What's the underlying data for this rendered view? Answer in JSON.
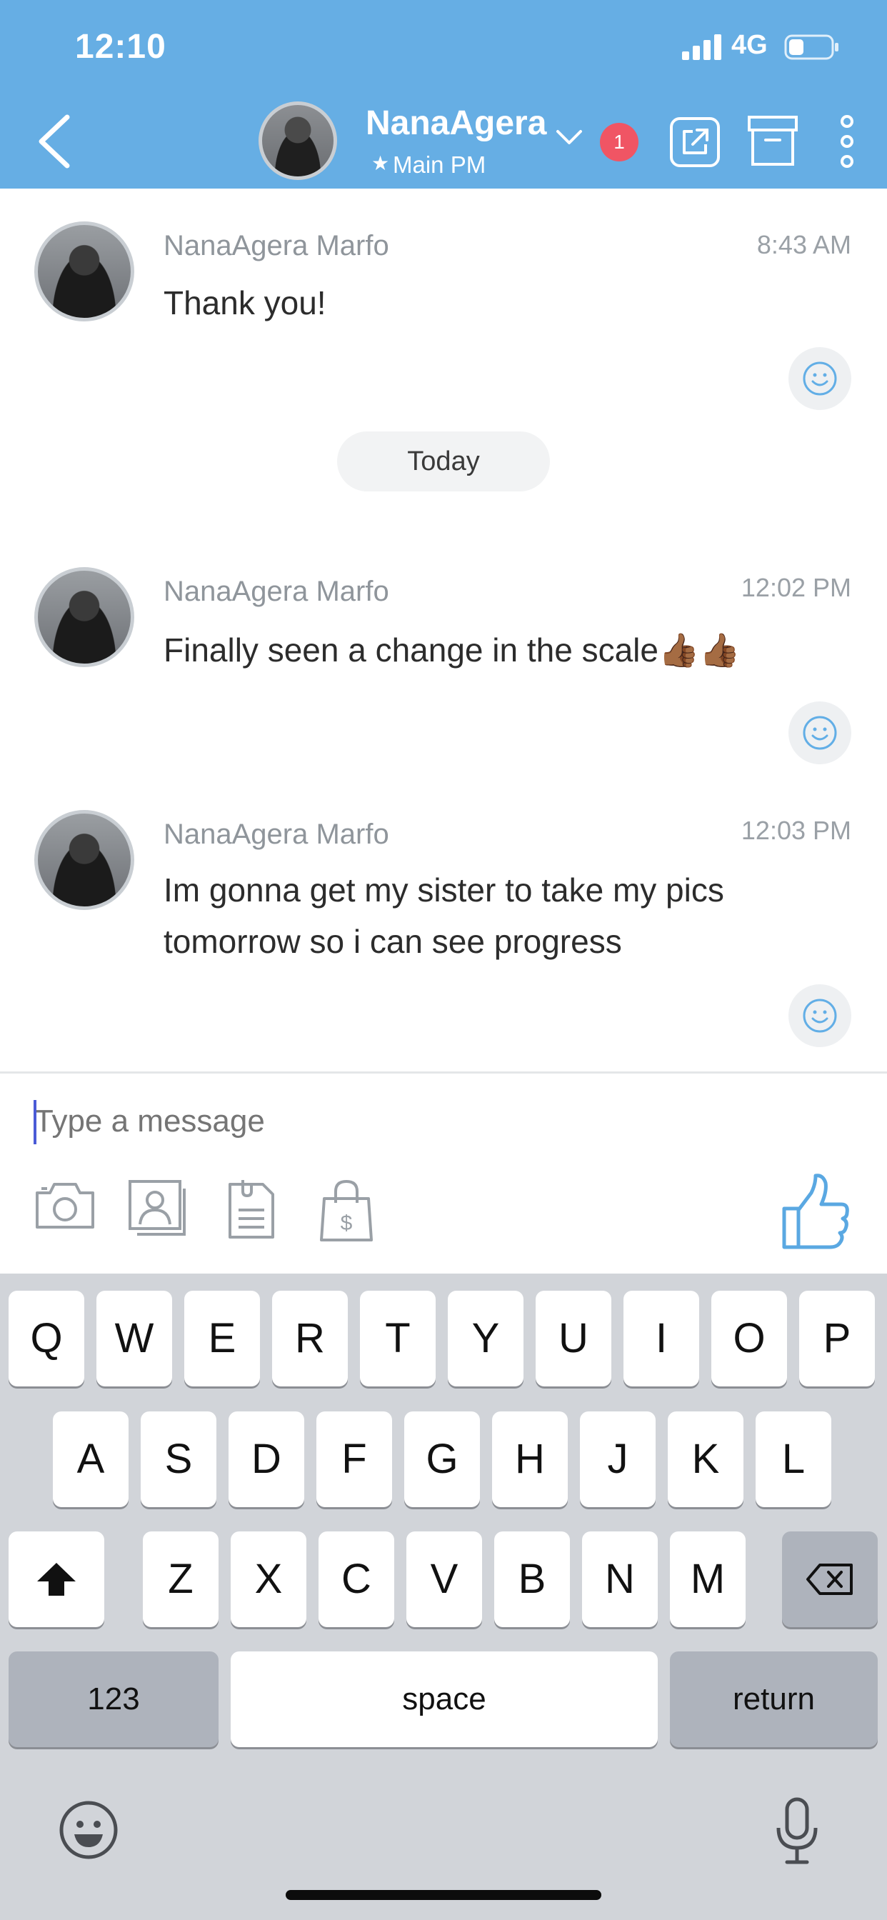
{
  "status_bar": {
    "time": "12:10",
    "network": "4G"
  },
  "header": {
    "name": "NanaAgera",
    "subtitle": "Main PM",
    "badge_count": "1",
    "icons": [
      "back-icon",
      "chevron-down-icon",
      "share-icon",
      "archive-icon",
      "more-icon"
    ]
  },
  "messages": [
    {
      "sender": "NanaAgera Marfo",
      "time": "8:43 AM",
      "text": "Thank you!"
    },
    {
      "sender": "NanaAgera Marfo",
      "time": "12:02 PM",
      "text": "Finally seen a change in the scale👍🏾👍🏾"
    },
    {
      "sender": "NanaAgera Marfo",
      "time": "12:03 PM",
      "text": "Im gonna get my sister to take my pics tomorrow so i can see progress"
    }
  ],
  "date_divider": "Today",
  "composer": {
    "placeholder": "Type a message",
    "tools": [
      "camera-icon",
      "contact-card-icon",
      "document-icon",
      "shopping-bag-icon",
      "thumbs-up-icon"
    ]
  },
  "keyboard": {
    "row1": [
      "Q",
      "W",
      "E",
      "R",
      "T",
      "Y",
      "U",
      "I",
      "O",
      "P"
    ],
    "row2": [
      "A",
      "S",
      "D",
      "F",
      "G",
      "H",
      "J",
      "K",
      "L"
    ],
    "row3": [
      "Z",
      "X",
      "C",
      "V",
      "B",
      "N",
      "M"
    ],
    "numbers_label": "123",
    "space_label": "space",
    "return_label": "return"
  },
  "colors": {
    "header": "#66aee4",
    "badge": "#f05564",
    "accent": "#4aa3e0"
  }
}
